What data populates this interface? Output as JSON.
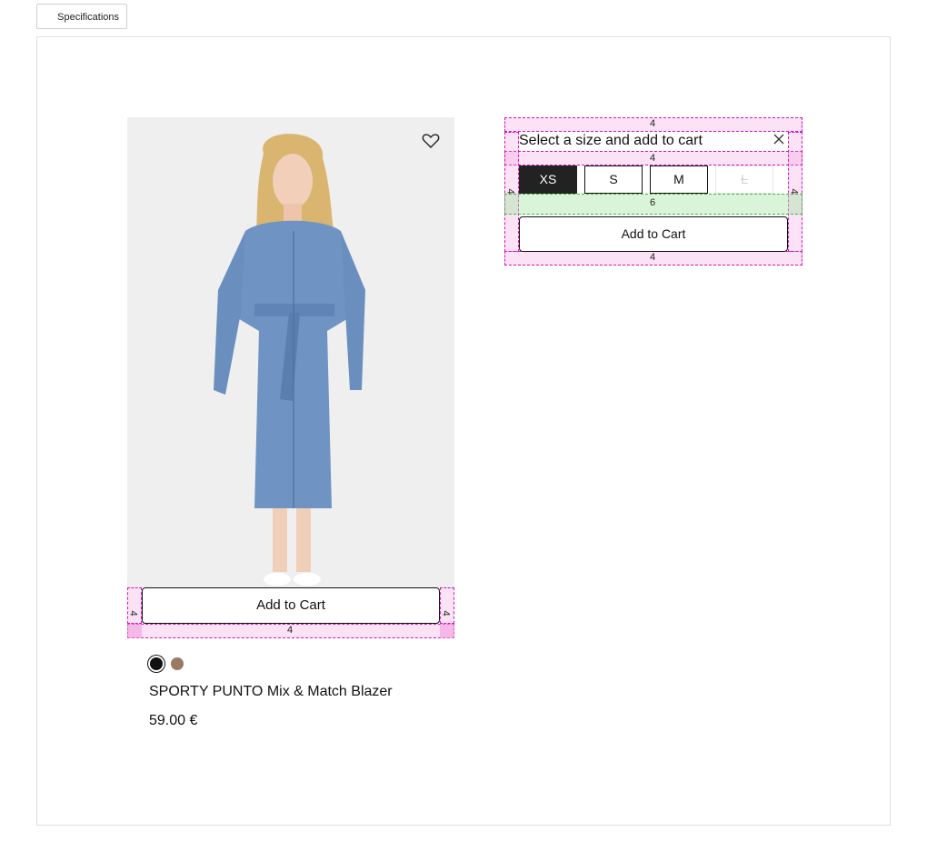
{
  "tabs": {
    "specifications": "Specifications"
  },
  "product": {
    "name": "SPORTY PUNTO Mix & Match Blazer",
    "price": "59.00 €",
    "add_to_cart": "Add to Cart",
    "colors": [
      {
        "name": "black",
        "hex": "#111111",
        "selected": true
      },
      {
        "name": "brown",
        "hex": "#9a7a62",
        "selected": false
      }
    ]
  },
  "size_panel": {
    "title": "Select a size and add to cart",
    "sizes": [
      {
        "label": "XS",
        "state": "selected"
      },
      {
        "label": "S",
        "state": "available"
      },
      {
        "label": "M",
        "state": "available"
      },
      {
        "label": "L",
        "state": "unavailable"
      }
    ],
    "add_to_cart": "Add to Cart"
  },
  "guides": {
    "panel_top": "4",
    "panel_mid": "4",
    "panel_left": "4",
    "panel_right": "4",
    "panel_gap": "6",
    "panel_bottom": "4",
    "card_left": "4",
    "card_right": "4",
    "card_bottom": "4"
  },
  "colors": {
    "accent": "#222222",
    "guide_pink": "#d316b9",
    "guide_green": "#46b44a"
  }
}
